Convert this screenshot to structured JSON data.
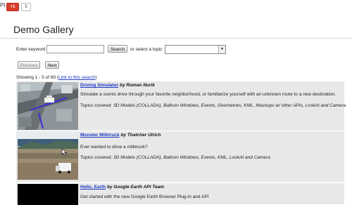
{
  "topbar": {
    "pi": "PI",
    "gplus_label": "+1",
    "gplus_count": "5"
  },
  "page_title": "Demo Gallery",
  "search": {
    "keyword_label": "Enter keyword",
    "keyword_value": "",
    "search_button": "Search",
    "topic_label": "or select a topic",
    "topic_selected": ""
  },
  "pager": {
    "previous": "Previous",
    "next": "Next"
  },
  "showing": {
    "text": "Showing 1 - 5 of 89 (",
    "link": "Link to this search",
    "close": ")"
  },
  "results": [
    {
      "title": "Driving Simulator",
      "by": "by Roman Nurik",
      "description": "Simulate a scenic drive through your favorite neighborhood, or familiarize yourself with an unknown route to a new destination.",
      "topics_label": "Topics covered:",
      "topics": "3D Models (COLLADA), Balloon Windows, Events, Geometries, KML, Mashups w/ other APIs, LookAt and Camera"
    },
    {
      "title": "Monster Milktruck",
      "by": "by Thatcher Ulrich",
      "description": "Ever wanted to drive a milktruck?",
      "topics_label": "Topics covered:",
      "topics": "3D Models (COLLADA), Balloon Windows, Events, KML, LookAt and Camera"
    },
    {
      "title": "Hello, Earth",
      "by": "by Google Earth API Team",
      "description": "Get started with the new Google Earth Browser Plug-in and API"
    }
  ],
  "colors": {
    "link": "#1a38c6",
    "row_bg": "#e8e8e8",
    "gplus": "#d93d2c"
  }
}
